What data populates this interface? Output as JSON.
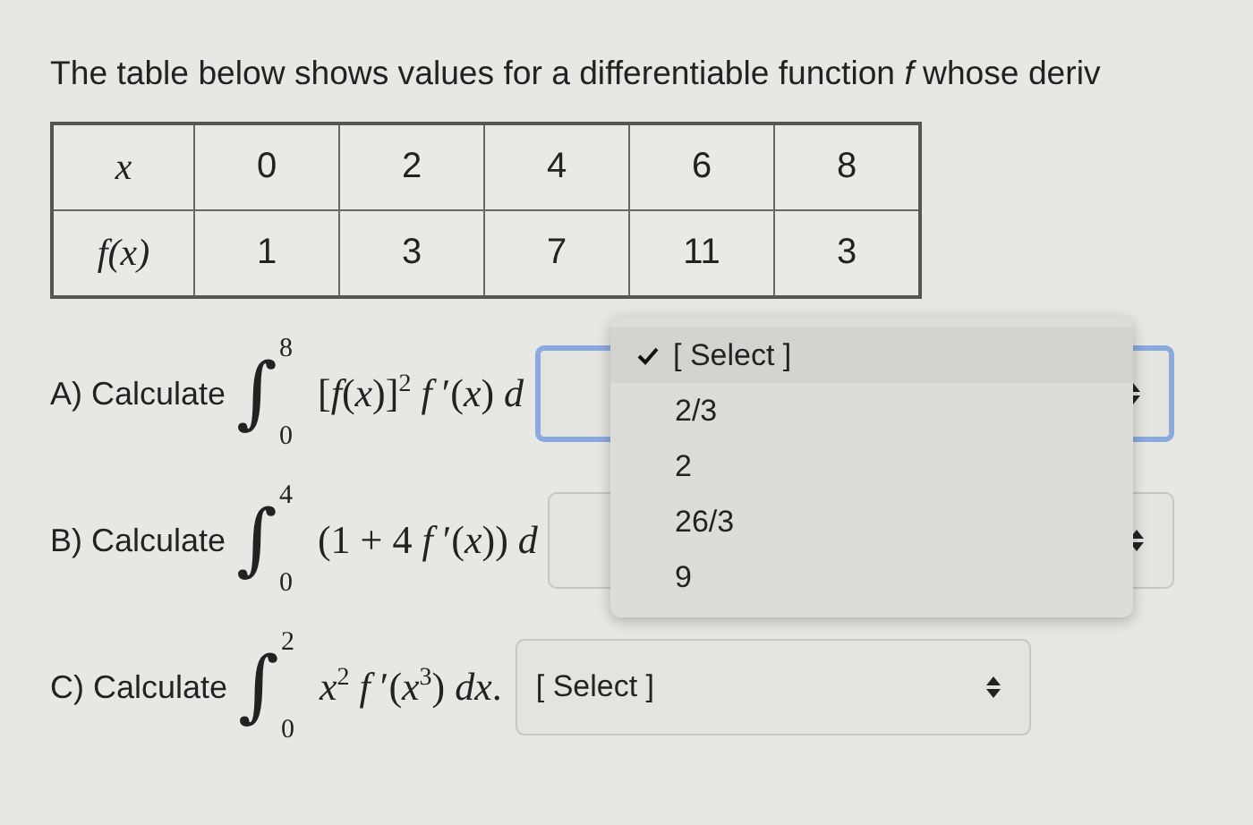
{
  "intro": "The table below shows values for a differentiable function *f* whose deriv",
  "table": {
    "rows": [
      {
        "head": "x",
        "cells": [
          "0",
          "2",
          "4",
          "6",
          "8"
        ]
      },
      {
        "head": "f(x)",
        "cells": [
          "1",
          "3",
          "7",
          "11",
          "3"
        ]
      }
    ]
  },
  "questions": [
    {
      "label": "A) Calculate",
      "integral": {
        "symbol": "∫",
        "upper": "8",
        "lower": "0"
      },
      "integrand": "[*f*(*x*)]$^{2}$ *f* ′(*x*) *d*",
      "select": {
        "focused": true
      }
    },
    {
      "label": "B) Calculate",
      "integral": {
        "symbol": "∫",
        "upper": "4",
        "lower": "0"
      },
      "integrand": "(1 + 4 *f* ′(*x*))  *d*",
      "select": {
        "focused": false
      }
    },
    {
      "label": "C) Calculate",
      "integral": {
        "symbol": "∫",
        "upper": "2",
        "lower": "0"
      },
      "integrand": "*x*$^{2}$ *f* ′(*x*$^{3}$) *dx*.",
      "select": {
        "focused": false,
        "value": "[ Select ]"
      }
    }
  ],
  "dropdown": {
    "options": [
      {
        "label": "[ Select ]",
        "selected": true
      },
      {
        "label": "2/3",
        "selected": false
      },
      {
        "label": "2",
        "selected": false
      },
      {
        "label": "26/3",
        "selected": false
      },
      {
        "label": "9",
        "selected": false
      }
    ]
  }
}
